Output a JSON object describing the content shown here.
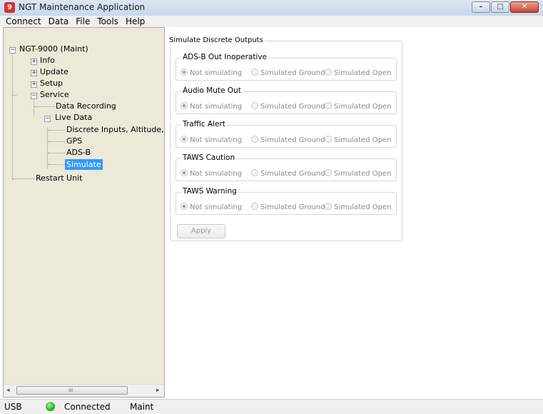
{
  "window": {
    "app_icon_text": "9",
    "title": "NGT Maintenance Application",
    "minimize_glyph": "–",
    "maximize_glyph": "□",
    "close_glyph": "✕"
  },
  "menu": [
    "Connect",
    "Data",
    "File",
    "Tools",
    "Help"
  ],
  "tree": {
    "root": "NGT-9000 (Maint)",
    "info": "Info",
    "update": "Update",
    "setup": "Setup",
    "service": "Service",
    "data_recording": "Data Recording",
    "live_data": "Live Data",
    "discrete_inputs": "Discrete Inputs, Altitude, an",
    "gps": "GPS",
    "adsb": "ADS-B",
    "simulate": "Simulate",
    "restart_unit": "Restart Unit",
    "collapsed_glyph": "+",
    "expanded_glyph": "−"
  },
  "scrollbar": {
    "left_arrow": "◂",
    "right_arrow": "▸",
    "grip": "III"
  },
  "simulate": {
    "title": "Simulate Discrete Outputs",
    "options": {
      "not_simulating": "Not simulating",
      "simulated_ground": "Simulated Ground",
      "simulated_open": "Simulated Open"
    },
    "groups": [
      {
        "label": "ADS-B Out Inoperative",
        "selected": "not_simulating"
      },
      {
        "label": "Audio Mute Out",
        "selected": "not_simulating"
      },
      {
        "label": "Traffic Alert",
        "selected": "not_simulating"
      },
      {
        "label": "TAWS Caution",
        "selected": "not_simulating"
      },
      {
        "label": "TAWS Warning",
        "selected": "not_simulating"
      }
    ],
    "apply_label": "Apply",
    "apply_enabled": false
  },
  "status": {
    "port": "USB",
    "connection": "Connected",
    "connection_color": "#26b226",
    "mode": "Maint"
  },
  "colors": {
    "selection": "#3399ff",
    "tree_background": "#ece9d8",
    "close_button": "#c7432f"
  }
}
